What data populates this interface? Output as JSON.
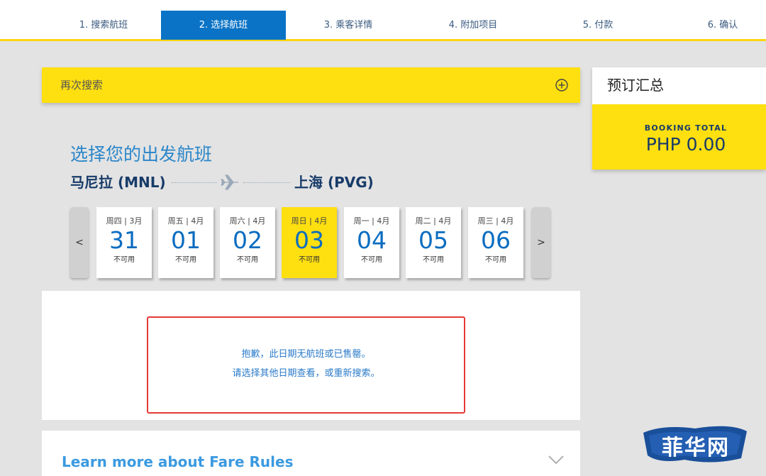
{
  "steps": [
    {
      "label": "1. 搜索航班"
    },
    {
      "label": "2. 选择航班",
      "active": true
    },
    {
      "label": "3. 乘客详情"
    },
    {
      "label": "4. 附加项目"
    },
    {
      "label": "5. 付款"
    },
    {
      "label": "6. 确认"
    }
  ],
  "research": {
    "label": "再次搜索",
    "icon": "plus-circle-icon"
  },
  "summary": {
    "title": "预订汇总",
    "total_label": "BOOKING TOTAL",
    "total_value": "PHP 0.00"
  },
  "heading": {
    "title": "选择您的出发航班",
    "origin": "马尼拉 (MNL)",
    "destination": "上海 (PVG)",
    "icon": "plane-icon"
  },
  "dates": {
    "prev_label": "<",
    "next_label": ">",
    "items": [
      {
        "dow": "周四 | 3月",
        "day": "31",
        "status": "不可用"
      },
      {
        "dow": "周五 | 4月",
        "day": "01",
        "status": "不可用"
      },
      {
        "dow": "周六 | 4月",
        "day": "02",
        "status": "不可用"
      },
      {
        "dow": "周日 | 4月",
        "day": "03",
        "status": "不可用",
        "selected": true
      },
      {
        "dow": "周一 | 4月",
        "day": "04",
        "status": "不可用"
      },
      {
        "dow": "周二 | 4月",
        "day": "05",
        "status": "不可用"
      },
      {
        "dow": "周三 | 4月",
        "day": "06",
        "status": "不可用"
      }
    ]
  },
  "message": {
    "line1": "抱歉，此日期无航班或已售罄。",
    "line2": "请选择其他日期查看，或重新搜索。"
  },
  "fare_rules": {
    "label": "Learn more about Fare Rules",
    "icon": "chevron-down-icon"
  },
  "watermark": {
    "text": "菲华网"
  },
  "colors": {
    "accent_yellow": "#fedf10",
    "active_blue": "#0a73c6",
    "navy": "#173b69",
    "error_red": "#e53935"
  }
}
